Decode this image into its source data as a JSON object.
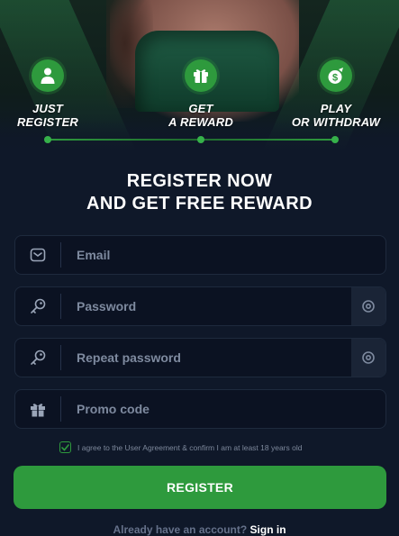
{
  "steps": [
    {
      "line1": "JUST",
      "line2": "REGISTER",
      "icon": "user-icon"
    },
    {
      "line1": "GET",
      "line2": "A REWARD",
      "icon": "gift-icon"
    },
    {
      "line1": "PLAY",
      "line2": "OR WITHDRAW",
      "icon": "money-bag-icon"
    }
  ],
  "heading": {
    "line1": "REGISTER NOW",
    "line2": "AND GET FREE REWARD"
  },
  "form": {
    "email_placeholder": "Email",
    "password_placeholder": "Password",
    "repeat_password_placeholder": "Repeat password",
    "promo_placeholder": "Promo code"
  },
  "agreement": {
    "text": "I agree to the User Agreement & confirm I am at least 18 years old",
    "checked": true
  },
  "register_label": "REGISTER",
  "signin": {
    "prompt": "Already have an account?",
    "link": "Sign in"
  },
  "colors": {
    "accent": "#2e9a3d",
    "background": "#0f1829",
    "field": "#0b1222"
  }
}
